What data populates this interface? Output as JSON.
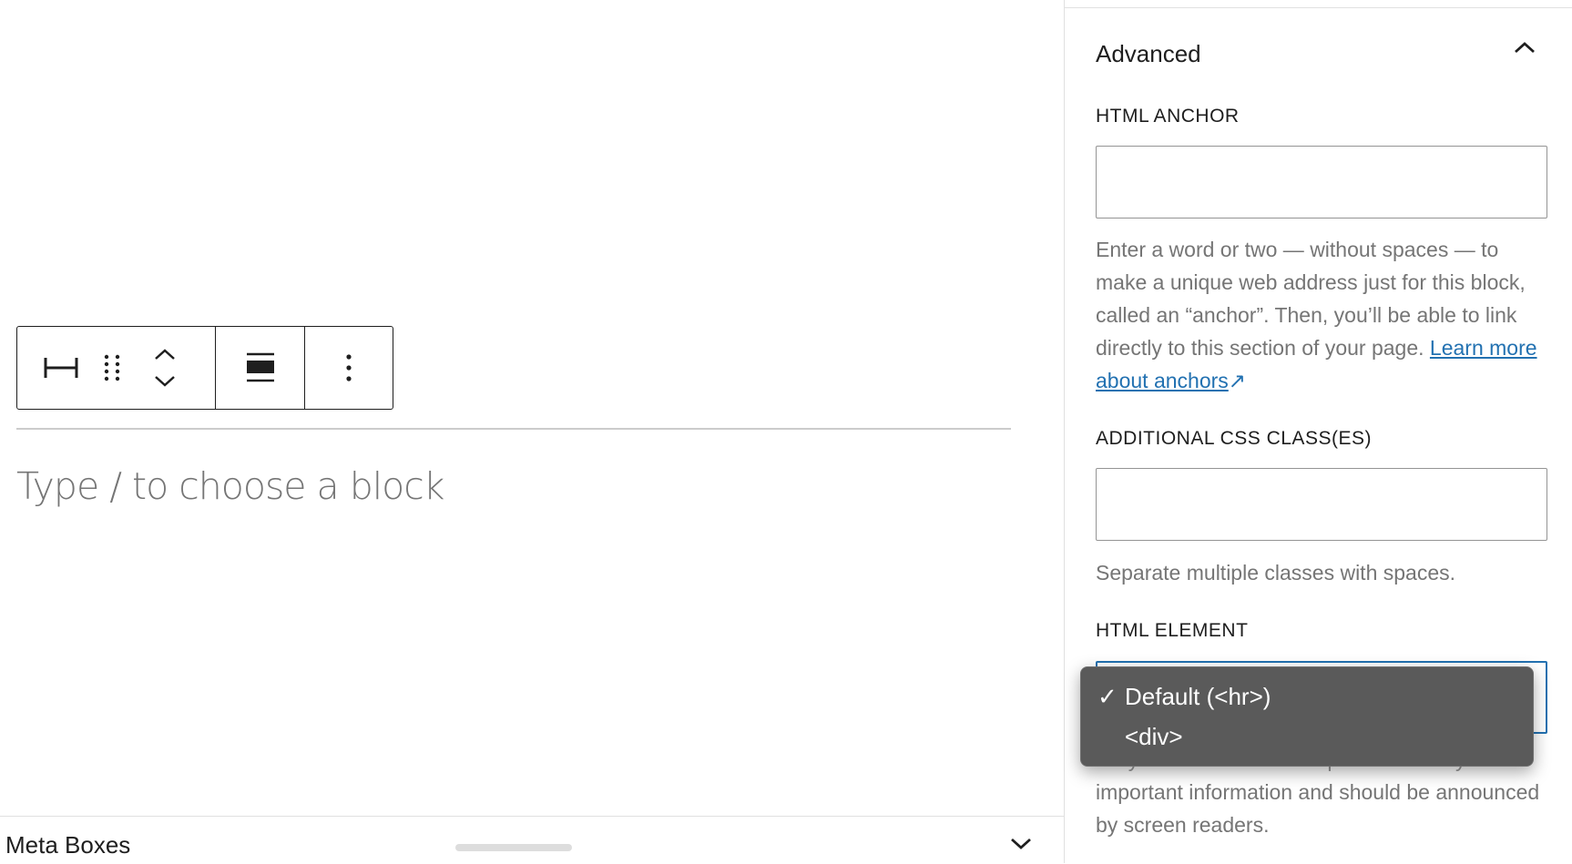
{
  "editor": {
    "placeholder": "Type / to choose a block"
  },
  "toolbar": {
    "icons": [
      "separator-block-icon",
      "drag-handle-icon",
      "move-up-icon",
      "move-down-icon",
      "align-wide-icon",
      "more-options-icon"
    ]
  },
  "metabox": {
    "title": "Meta Boxes"
  },
  "sidebar": {
    "panel_title": "Advanced",
    "html_anchor": {
      "label": "HTML ANCHOR",
      "value": "",
      "help": "Enter a word or two — without spaces — to make a unique web address just for this block, called an “anchor”. Then, you’ll be able to link directly to this section of your page. ",
      "link_text": "Learn more about anchors",
      "link_arrow": "↗"
    },
    "css_classes": {
      "label": "ADDITIONAL CSS CLASS(ES)",
      "value": "",
      "help": "Separate multiple classes with spaces."
    },
    "html_element": {
      "label": "HTML ELEMENT",
      "selected": "Default (<hr>)",
      "options": [
        "Default (<hr>)",
        "<div>"
      ],
      "help_line1": "Only select <hr> if the separator conveys",
      "help_rest": "important information and should be announced by screen readers."
    }
  },
  "colors": {
    "accent": "#2271b1",
    "text": "#1e1e1e",
    "muted": "#757575",
    "dropdown_bg": "#5a5a5a"
  }
}
